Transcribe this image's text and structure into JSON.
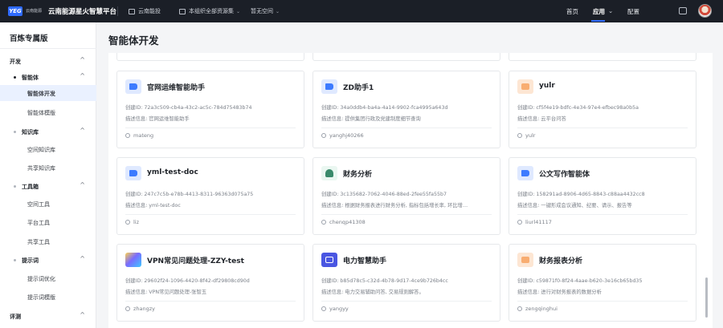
{
  "topbar": {
    "logo_mark": "YEG",
    "logo_org": "云南能源",
    "platform_title": "云南能源星火智慧平台",
    "nav": [
      {
        "label": "云南能投"
      },
      {
        "label": "本组织全部资源集"
      },
      {
        "label": "暂无空间"
      }
    ],
    "tabs": [
      {
        "label": "首页"
      },
      {
        "label": "应用"
      },
      {
        "label": "配置"
      }
    ]
  },
  "sidebar": {
    "title": "百炼专属版",
    "items": [
      {
        "label": "开发"
      },
      {
        "label": "智能体"
      },
      {
        "label": "智能体开发"
      },
      {
        "label": "智能体模版"
      },
      {
        "label": "知识库"
      },
      {
        "label": "空间知识库"
      },
      {
        "label": "共享知识库"
      },
      {
        "label": "工具箱"
      },
      {
        "label": "空间工具"
      },
      {
        "label": "平台工具"
      },
      {
        "label": "共享工具"
      },
      {
        "label": "提示词"
      },
      {
        "label": "提示词优化"
      },
      {
        "label": "提示词模版"
      },
      {
        "label": "评测"
      }
    ]
  },
  "main": {
    "title": "智能体开发",
    "cards": [
      {
        "name": "官网运维智能助手",
        "id": "创建ID: 72a3c509-cb4a-43c2-ac5c-784d75483b74",
        "desc": "描述信息: 官网运维智能助手",
        "owner": "mateng"
      },
      {
        "name": "ZD助手1",
        "id": "创建ID: 34a0ddb4-ba4a-4a14-9902-fca4995a643d",
        "desc": "描述信息: 提供集团行政及党建制度细节查询",
        "owner": "yanghj40266"
      },
      {
        "name": "yulr",
        "id": "创建ID: cf5f4e19-bdfc-4e34-97e4-efbec98a0b5a",
        "desc": "描述信息: 云平台问答",
        "owner": "yulr"
      },
      {
        "name": "yml-test-doc",
        "id": "创建ID: 247c7c5b-e78b-4413-8311-96363d075a75",
        "desc": "描述信息: yml-test-doc",
        "owner": "liz"
      },
      {
        "name": "财务分析",
        "id": "创建ID: 3c135682-7062-4046-88ed-2fee55fa55b7",
        "desc": "描述信息: 根据财务报表进行财务分析, 指标包括增长率, 环比增…",
        "owner": "chenqp41308"
      },
      {
        "name": "公文写作智能体",
        "id": "创建ID: 158291ad-8906-4d65-8843-c88aa4432cc8",
        "desc": "描述信息: 一键形成会议通知、纪要、请示、报告等",
        "owner": "liurl41117"
      },
      {
        "name": "VPN常见问题处理-ZZY-test",
        "id": "创建ID: 29602f24-1096-4420-8f42-df29808cd90d",
        "desc": "描述信息: VPN常见问题处理-张智玉",
        "owner": "zhangzy"
      },
      {
        "name": "电力智慧助手",
        "id": "创建ID: b85d78c5-c32d-4b78-9d17-4ce9b726b4cc",
        "desc": "描述信息: 电力交易辅助问答, 交易规则解答。",
        "owner": "yangyy"
      },
      {
        "name": "财务报表分析",
        "id": "创建ID: c59871f0-8f24-4aae-b620-3e16cb65bd35",
        "desc": "描述信息: 进行对财务报表的数据分析",
        "owner": "zengqinghui"
      }
    ]
  }
}
